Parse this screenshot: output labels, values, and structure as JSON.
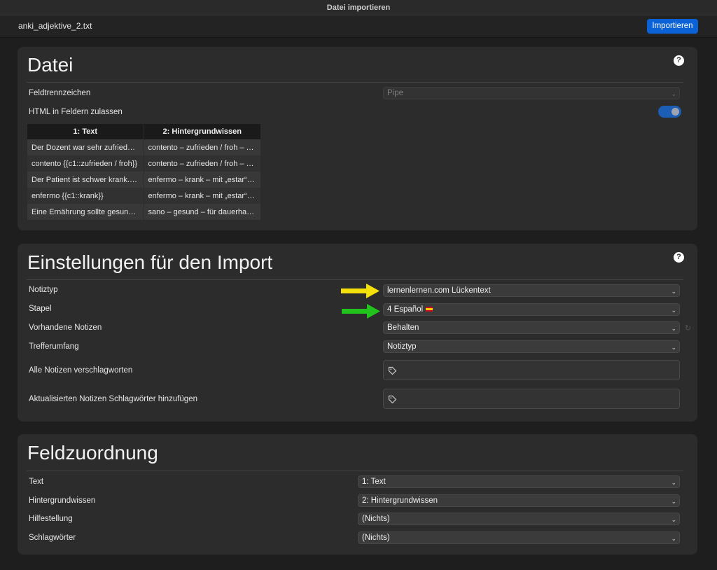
{
  "window": {
    "title": "Datei importieren"
  },
  "header": {
    "filename": "anki_adjektive_2.txt",
    "import_label": "Importieren"
  },
  "file_section": {
    "title": "Datei",
    "help": "?",
    "separator_label": "Feldtrennzeichen",
    "separator_value": "Pipe",
    "html_label": "HTML in Feldern zulassen",
    "html_enabled": true,
    "table": {
      "headers": [
        "1: Text",
        "2: Hintergrundwissen"
      ],
      "rows": [
        [
          "Der Dozent war sehr zufried…",
          "contento – zufrieden / froh – …"
        ],
        [
          "contento {{c1::zufrieden / froh}}",
          "contento – zufrieden / froh – …"
        ],
        [
          "Der Patient ist schwer krank.…",
          "enfermo – krank – mit „estar“…"
        ],
        [
          "enfermo {{c1::krank}}",
          "enfermo – krank – mit „estar“…"
        ],
        [
          "Eine Ernährung sollte gesun…",
          "sano – gesund – für dauerha…"
        ]
      ]
    }
  },
  "import_settings": {
    "title": "Einstellungen für den Import",
    "help": "?",
    "notetype_label": "Notiztyp",
    "notetype_value": "lernenlernen.com Lückentext",
    "deck_label": "Stapel",
    "deck_value": "4 Español",
    "existing_label": "Vorhandene Notizen",
    "existing_value": "Behalten",
    "match_label": "Trefferumfang",
    "match_value": "Notiztyp",
    "tag_all_label": "Alle Notizen verschlagworten",
    "tag_updated_label": "Aktualisierten Notizen Schlagwörter hinzufügen"
  },
  "field_mapping": {
    "title": "Feldzuordnung",
    "rows": [
      {
        "label": "Text",
        "value": "1: Text"
      },
      {
        "label": "Hintergrundwissen",
        "value": "2: Hintergrundwissen"
      },
      {
        "label": "Hilfestellung",
        "value": "(Nichts)"
      },
      {
        "label": "Schlagwörter",
        "value": "(Nichts)"
      }
    ]
  },
  "colors": {
    "accent": "#0a62d6",
    "arrow_yellow": "#f5e10a",
    "arrow_green": "#22c31c"
  }
}
